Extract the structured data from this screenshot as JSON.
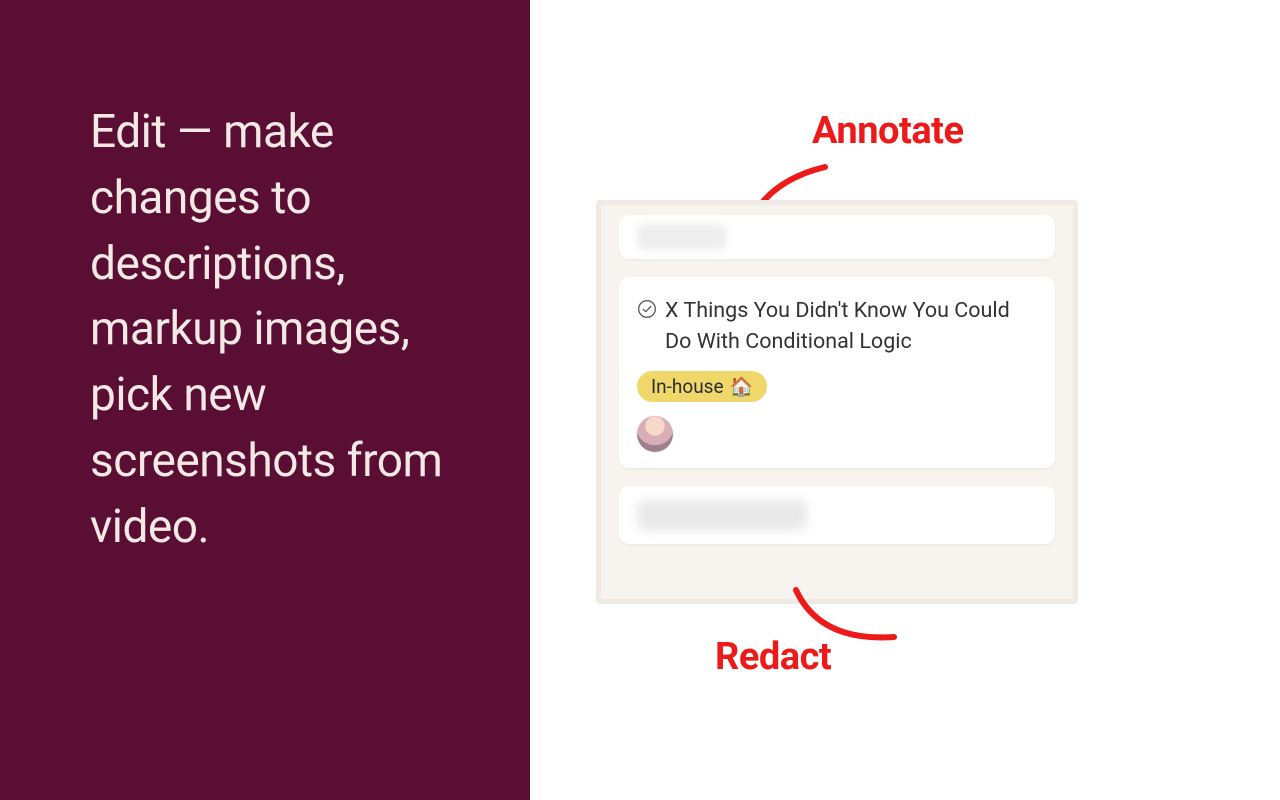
{
  "left_panel": {
    "text": "Edit — make changes to descriptions, markup images, pick new screenshots from video."
  },
  "annotations": {
    "annotate_label": "Annotate",
    "redact_label": "Redact"
  },
  "screenshot": {
    "card": {
      "title": "X Things You Didn't Know You Could Do With Conditional Logic",
      "tag_text": "In-house",
      "tag_emoji": "🏠",
      "check_icon": "check-circle"
    }
  },
  "colors": {
    "left_bg": "#5a0e34",
    "annotation_red": "#ed1a1a",
    "tag_bg": "#efd76a"
  }
}
